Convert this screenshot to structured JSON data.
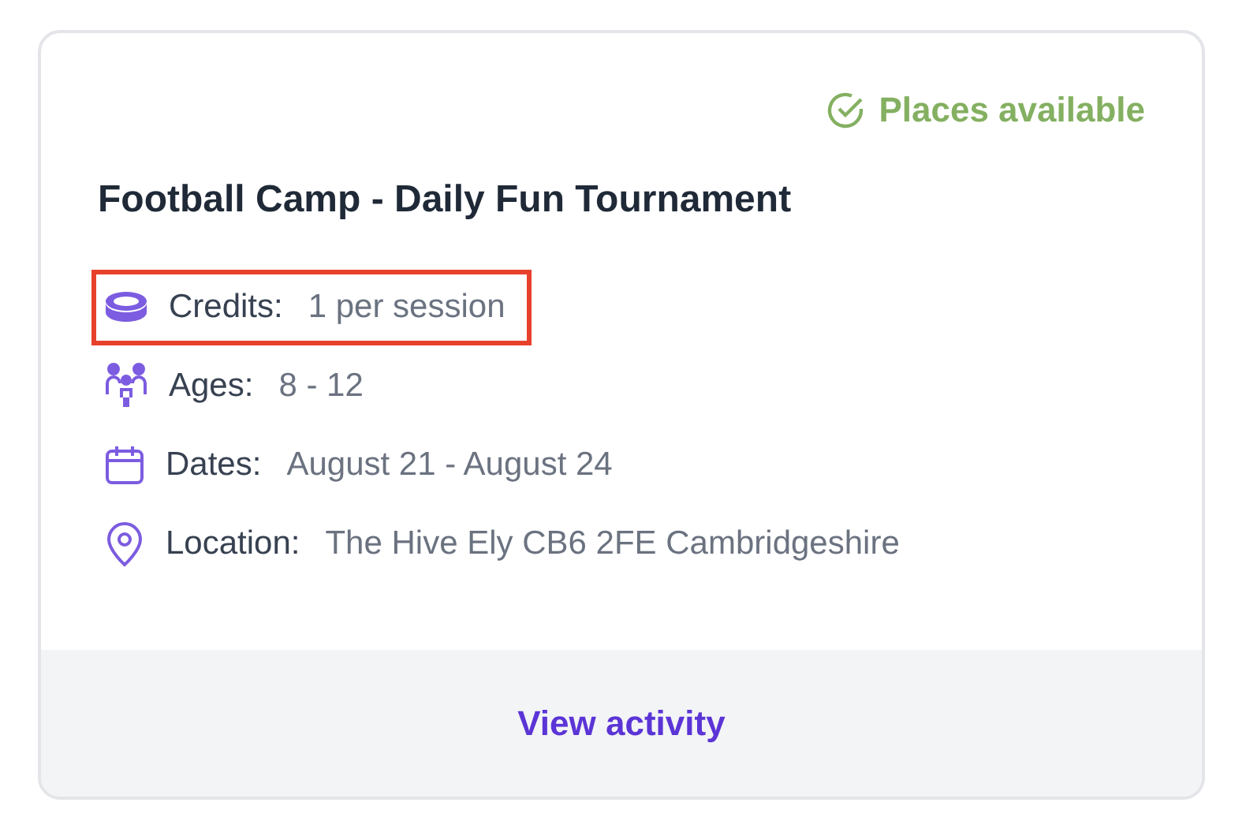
{
  "status": {
    "label": "Places available"
  },
  "title": "Football Camp - Daily Fun Tournament",
  "details": [
    {
      "kind": "credits",
      "label": "Credits:",
      "value": "1 per session",
      "highlighted": true
    },
    {
      "kind": "ages",
      "label": "Ages:",
      "value": "8 - 12",
      "highlighted": false
    },
    {
      "kind": "dates",
      "label": "Dates:",
      "value": "August 21 - August 24",
      "highlighted": false
    },
    {
      "kind": "location",
      "label": "Location:",
      "value": "The Hive Ely CB6 2FE Cambridgeshire",
      "highlighted": false
    }
  ],
  "action": "View activity"
}
